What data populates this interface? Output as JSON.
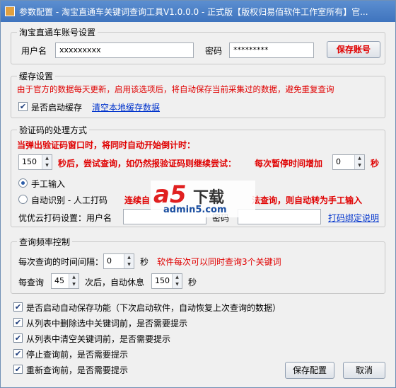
{
  "window": {
    "title": "参数配置 - 淘宝直通车关键词查询工具V1.0.0.0 - 正式版【版权归易佰软件工作室所有】官..."
  },
  "account": {
    "group_label": "淘宝直通车账号设置",
    "username_label": "用户名",
    "username_value": "xxxxxxxxx",
    "password_label": "密码",
    "password_value": "*********",
    "save_button": "保存账号"
  },
  "cache": {
    "group_label": "缓存设置",
    "notice": "由于官方的数据每天更新，启用该选项后，将自动保存当前采集过的数据，避免重复查询",
    "enable_label": "是否启动缓存",
    "enable_checked": true,
    "clear_link": "清空本地缓存数据"
  },
  "captcha": {
    "group_label": "验证码的处理方式",
    "notice": "当弹出验证码窗口时，将同时自动开始倒计时：",
    "countdown_value": "150",
    "retry_text": "秒后，尝试查询，如仍然报验证码则继续尝试：",
    "increase_text": "每次暂停时间增加",
    "increase_value": "0",
    "seconds_unit": "秒",
    "manual_label": "手工输入",
    "manual_selected": true,
    "auto_label": "自动识别 - 人工打码",
    "auto_selected": false,
    "fail_text_left": "连续自",
    "fail_text_right": "法查询，则自动转为手工输入",
    "provider_label": "优优云打码设置：用户名",
    "provider_username_value": "",
    "provider_password_label": "密码",
    "provider_password_value": "",
    "bind_link": "打码绑定说明"
  },
  "frequency": {
    "group_label": "查询频率控制",
    "interval_label": "每次查询的时间间隔：",
    "interval_value": "0",
    "interval_unit": "秒",
    "interval_note": "软件每次可以同时查询3个关键词",
    "every_label": "每查询",
    "every_value": "45",
    "rest_label": "次后，自动休息",
    "rest_value": "150",
    "rest_unit": "秒"
  },
  "options": [
    {
      "label": "是否启动自动保存功能（下次启动软件，自动恢复上次查询的数据）",
      "checked": true
    },
    {
      "label": "从列表中删除选中关键词前，是否需要提示",
      "checked": true
    },
    {
      "label": "从列表中清空关键词前，是否需要提示",
      "checked": true
    },
    {
      "label": "停止查询前，是否需要提示",
      "checked": true
    },
    {
      "label": "重新查询前，是否需要提示",
      "checked": true
    }
  ],
  "footer": {
    "save_button": "保存配置",
    "cancel_button": "取消"
  },
  "watermark": {
    "logo": "a5",
    "text": "下载",
    "site": "admin5.com"
  }
}
